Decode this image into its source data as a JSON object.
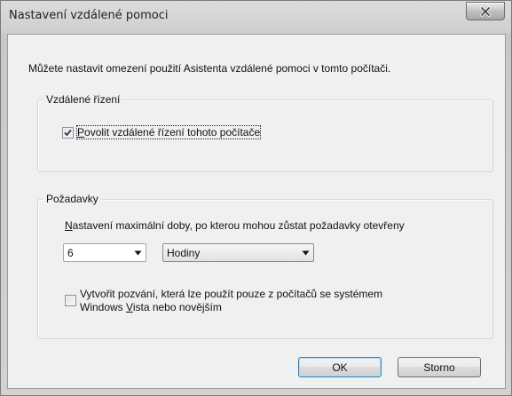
{
  "window": {
    "title": "Nastavení vzdálené pomoci",
    "close_icon": "close-icon"
  },
  "intro_text": "Můžete nastavit omezení použití Asistenta vzdálené pomoci v tomto počítači.",
  "remote_control": {
    "legend": "Vzdálené řízení",
    "allow_checkbox": {
      "checked": true,
      "label_hotkey": "P",
      "label_rest": "ovolit vzdálené řízení tohoto počítače"
    }
  },
  "invitations": {
    "legend": "Požadavky",
    "duration_label_hotkey": "N",
    "duration_label_rest": "astavení maximální doby, po kterou mohou zůstat požadavky otevřeny",
    "duration_value": "6",
    "duration_unit": "Hodiny",
    "vista_checkbox": {
      "checked": false,
      "label_line1": "Vytvořit pozvání, která lze použít pouze z počítačů se systémem",
      "label_line2_before": "Windows ",
      "label_line2_hotkey": "V",
      "label_line2_after": "ista nebo novějším"
    }
  },
  "buttons": {
    "ok": "OK",
    "cancel": "Storno"
  }
}
